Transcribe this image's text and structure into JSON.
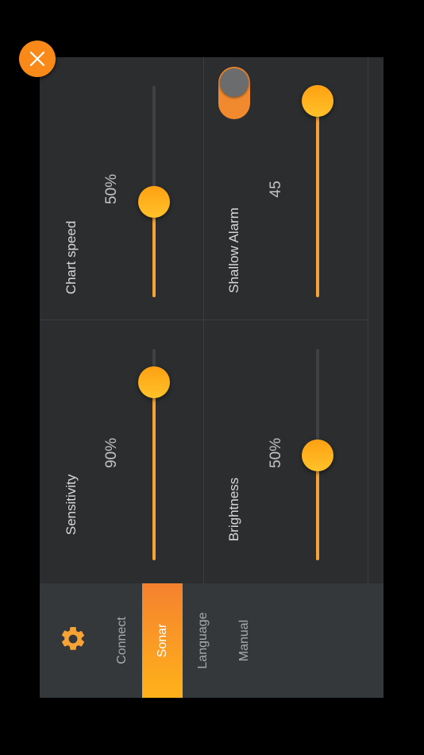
{
  "nav": {
    "items": [
      {
        "label": "Connect",
        "active": false
      },
      {
        "label": "Sonar",
        "active": true
      },
      {
        "label": "Language",
        "active": false
      },
      {
        "label": "Manual",
        "active": false
      }
    ]
  },
  "settings": {
    "sensitivity": {
      "title": "Sensitivity",
      "value_text": "90%",
      "level": 0.9
    },
    "chart_speed": {
      "title": "Chart speed",
      "value_text": "50%",
      "level": 0.5
    },
    "brightness": {
      "title": "Brightness",
      "value_text": "50%",
      "level": 0.5
    },
    "shallow_alarm": {
      "title": "Shallow Alarm",
      "value_text": "45",
      "enabled": false,
      "level": 1.0
    }
  },
  "colors": {
    "accent": "#f7a235",
    "panel": "#2b2d2f",
    "nav": "#35383b"
  },
  "icons": {
    "close": "close-icon",
    "settings": "gear-icon"
  }
}
